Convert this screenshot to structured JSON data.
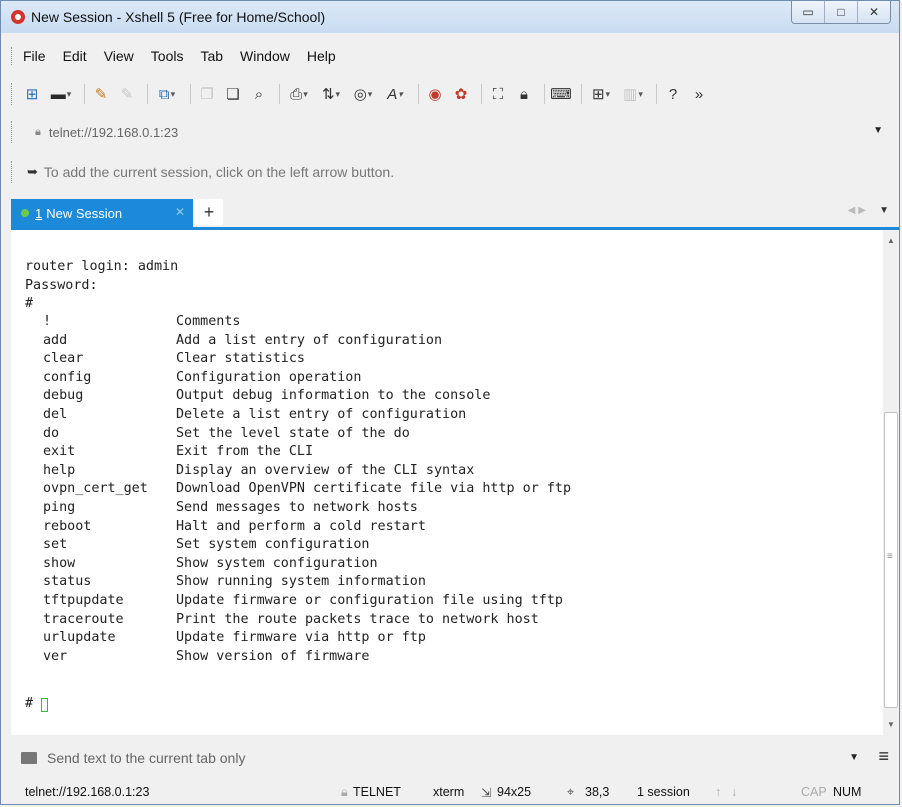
{
  "window": {
    "title": "New Session - Xshell 5 (Free for Home/School)",
    "controls": [
      "minimize-icon",
      "maximize-icon",
      "close-icon"
    ]
  },
  "menu": [
    "File",
    "Edit",
    "View",
    "Tools",
    "Tab",
    "Window",
    "Help"
  ],
  "toolbar": {
    "icons": [
      "new-session-icon",
      "open-folder-icon",
      "reconnect-icon",
      "disconnect-icon",
      "new-tab-icon",
      "copy-icon",
      "paste-icon",
      "find-icon",
      "print-icon",
      "transfer-icon",
      "globe-icon",
      "font-icon",
      "xftp-icon",
      "xmanager-icon",
      "fullscreen-icon",
      "lock-icon",
      "keyboard-icon",
      "add-panel-icon",
      "layout-icon",
      "help-icon",
      "overflow-icon"
    ]
  },
  "address": {
    "value": "telnet://192.168.0.1:23"
  },
  "hint": {
    "text": "To add the current session, click on the left arrow button."
  },
  "tabs": [
    {
      "number": "1",
      "label": "New Session"
    }
  ],
  "terminal": {
    "header_lines": [
      "router login: admin",
      "Password:",
      "#"
    ],
    "commands": [
      {
        "cmd": "!",
        "desc": "Comments"
      },
      {
        "cmd": "add",
        "desc": "Add a list entry of configuration"
      },
      {
        "cmd": "clear",
        "desc": "Clear statistics"
      },
      {
        "cmd": "config",
        "desc": "Configuration operation"
      },
      {
        "cmd": "debug",
        "desc": "Output debug information to the console"
      },
      {
        "cmd": "del",
        "desc": "Delete a list entry of configuration"
      },
      {
        "cmd": "do",
        "desc": "Set the level state of the do"
      },
      {
        "cmd": "exit",
        "desc": "Exit from the CLI"
      },
      {
        "cmd": "help",
        "desc": "Display an overview of the CLI syntax"
      },
      {
        "cmd": "ovpn_cert_get",
        "desc": "Download OpenVPN certificate file via http or ftp"
      },
      {
        "cmd": "ping",
        "desc": "Send messages to network hosts"
      },
      {
        "cmd": "reboot",
        "desc": "Halt and perform a cold restart"
      },
      {
        "cmd": "set",
        "desc": "Set system configuration"
      },
      {
        "cmd": "show",
        "desc": "Show system configuration"
      },
      {
        "cmd": "status",
        "desc": "Show running system information"
      },
      {
        "cmd": "tftpupdate",
        "desc": "Update firmware or configuration file using tftp"
      },
      {
        "cmd": "traceroute",
        "desc": "Print the route packets trace to network host"
      },
      {
        "cmd": "urlupdate",
        "desc": "Update firmware via http or ftp"
      },
      {
        "cmd": "ver",
        "desc": "Show version of firmware"
      }
    ],
    "prompt": "#"
  },
  "compose": {
    "text": "Send text to the current tab only"
  },
  "statusbar": {
    "address": "telnet://192.168.0.1:23",
    "protocol": "TELNET",
    "terminal_type": "xterm",
    "size": "94x25",
    "cursor_pos": "38,3",
    "sessions": "1 session",
    "caps": "CAP",
    "num": "NUM"
  }
}
